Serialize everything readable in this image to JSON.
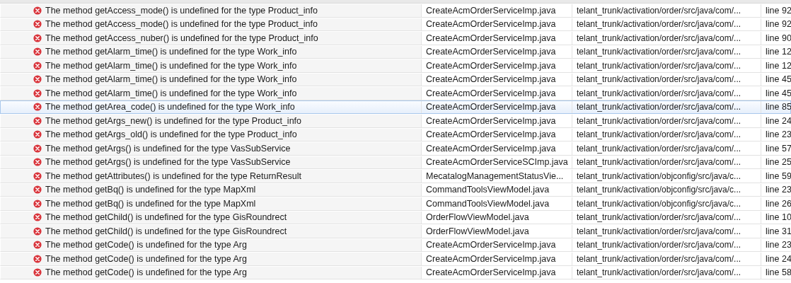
{
  "problems": [
    {
      "description": "The method getAccess_mode() is undefined for the type Product_info",
      "resource": "CreateAcmOrderServiceImp.java",
      "path": "telant_trunk/activation/order/src/java/com/...",
      "location": "line 92",
      "selected": false
    },
    {
      "description": "The method getAccess_mode() is undefined for the type Product_info",
      "resource": "CreateAcmOrderServiceImp.java",
      "path": "telant_trunk/activation/order/src/java/com/...",
      "location": "line 92",
      "selected": false
    },
    {
      "description": "The method getAccess_nuber() is undefined for the type Product_info",
      "resource": "CreateAcmOrderServiceImp.java",
      "path": "telant_trunk/activation/order/src/java/com/...",
      "location": "line 90",
      "selected": false
    },
    {
      "description": "The method getAlarm_time() is undefined for the type Work_info",
      "resource": "CreateAcmOrderServiceImp.java",
      "path": "telant_trunk/activation/order/src/java/com/...",
      "location": "line 12",
      "selected": false
    },
    {
      "description": "The method getAlarm_time() is undefined for the type Work_info",
      "resource": "CreateAcmOrderServiceImp.java",
      "path": "telant_trunk/activation/order/src/java/com/...",
      "location": "line 12",
      "selected": false
    },
    {
      "description": "The method getAlarm_time() is undefined for the type Work_info",
      "resource": "CreateAcmOrderServiceImp.java",
      "path": "telant_trunk/activation/order/src/java/com/...",
      "location": "line 45",
      "selected": false
    },
    {
      "description": "The method getAlarm_time() is undefined for the type Work_info",
      "resource": "CreateAcmOrderServiceImp.java",
      "path": "telant_trunk/activation/order/src/java/com/...",
      "location": "line 45",
      "selected": false
    },
    {
      "description": "The method getArea_code() is undefined for the type Work_info",
      "resource": "CreateAcmOrderServiceImp.java",
      "path": "telant_trunk/activation/order/src/java/com/...",
      "location": "line 85",
      "selected": true
    },
    {
      "description": "The method getArgs_new() is undefined for the type Product_info",
      "resource": "CreateAcmOrderServiceImp.java",
      "path": "telant_trunk/activation/order/src/java/com/...",
      "location": "line 24",
      "selected": false
    },
    {
      "description": "The method getArgs_old() is undefined for the type Product_info",
      "resource": "CreateAcmOrderServiceImp.java",
      "path": "telant_trunk/activation/order/src/java/com/...",
      "location": "line 23",
      "selected": false
    },
    {
      "description": "The method getArgs() is undefined for the type VasSubService",
      "resource": "CreateAcmOrderServiceImp.java",
      "path": "telant_trunk/activation/order/src/java/com/...",
      "location": "line 57",
      "selected": false
    },
    {
      "description": "The method getArgs() is undefined for the type VasSubService",
      "resource": "CreateAcmOrderServiceSCImp.java",
      "path": "telant_trunk/activation/order/src/java/com/...",
      "location": "line 25",
      "selected": false
    },
    {
      "description": "The method getAttributes() is undefined for the type ReturnResult",
      "resource": "MecatalogManagementStatusVie...",
      "path": "telant_trunk/activation/objconfig/src/java/c...",
      "location": "line 59",
      "selected": false
    },
    {
      "description": "The method getBq() is undefined for the type MapXml",
      "resource": "CommandToolsViewModel.java",
      "path": "telant_trunk/activation/objconfig/src/java/c...",
      "location": "line 23",
      "selected": false
    },
    {
      "description": "The method getBq() is undefined for the type MapXml",
      "resource": "CommandToolsViewModel.java",
      "path": "telant_trunk/activation/objconfig/src/java/c...",
      "location": "line 26",
      "selected": false
    },
    {
      "description": "The method getChild() is undefined for the type GisRoundrect",
      "resource": "OrderFlowViewModel.java",
      "path": "telant_trunk/activation/order/src/java/com/...",
      "location": "line 10",
      "selected": false
    },
    {
      "description": "The method getChild() is undefined for the type GisRoundrect",
      "resource": "OrderFlowViewModel.java",
      "path": "telant_trunk/activation/order/src/java/com/...",
      "location": "line 31",
      "selected": false
    },
    {
      "description": "The method getCode() is undefined for the type Arg",
      "resource": "CreateAcmOrderServiceImp.java",
      "path": "telant_trunk/activation/order/src/java/com/...",
      "location": "line 23",
      "selected": false
    },
    {
      "description": "The method getCode() is undefined for the type Arg",
      "resource": "CreateAcmOrderServiceImp.java",
      "path": "telant_trunk/activation/order/src/java/com/...",
      "location": "line 24",
      "selected": false
    },
    {
      "description": "The method getCode() is undefined for the type Arg",
      "resource": "CreateAcmOrderServiceImp.java",
      "path": "telant_trunk/activation/order/src/java/com/...",
      "location": "line 58",
      "selected": false
    }
  ]
}
